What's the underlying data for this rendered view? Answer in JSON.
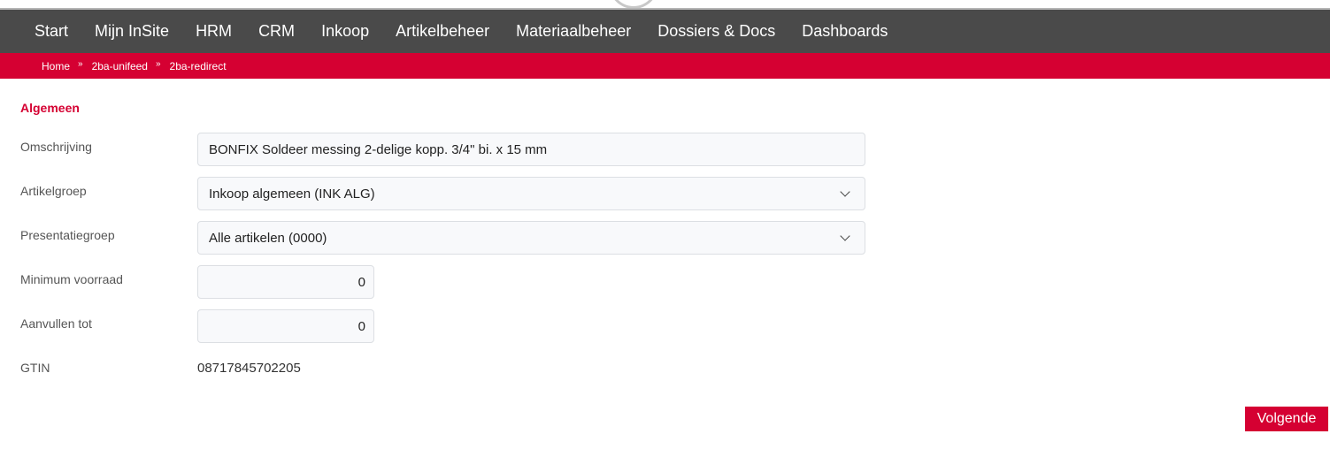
{
  "nav": {
    "items": [
      "Start",
      "Mijn InSite",
      "HRM",
      "CRM",
      "Inkoop",
      "Artikelbeheer",
      "Materiaalbeheer",
      "Dossiers & Docs",
      "Dashboards"
    ]
  },
  "breadcrumb": {
    "items": [
      "Home",
      "2ba-unifeed",
      "2ba-redirect"
    ],
    "separator": "»"
  },
  "form": {
    "section_title": "Algemeen",
    "omschrijving": {
      "label": "Omschrijving",
      "value": "BONFIX Soldeer messing 2-delige kopp. 3/4\" bi. x 15 mm"
    },
    "artikelgroep": {
      "label": "Artikelgroep",
      "value": "Inkoop algemeen (INK ALG)"
    },
    "presentatiegroep": {
      "label": "Presentatiegroep",
      "value": "Alle artikelen (0000)"
    },
    "minimum_voorraad": {
      "label": "Minimum voorraad",
      "value": "0"
    },
    "aanvullen_tot": {
      "label": "Aanvullen tot",
      "value": "0"
    },
    "gtin": {
      "label": "GTIN",
      "value": "08717845702205"
    }
  },
  "actions": {
    "next_label": "Volgende"
  },
  "colors": {
    "brand_red": "#d50032",
    "nav_background": "#4a4a4a"
  }
}
